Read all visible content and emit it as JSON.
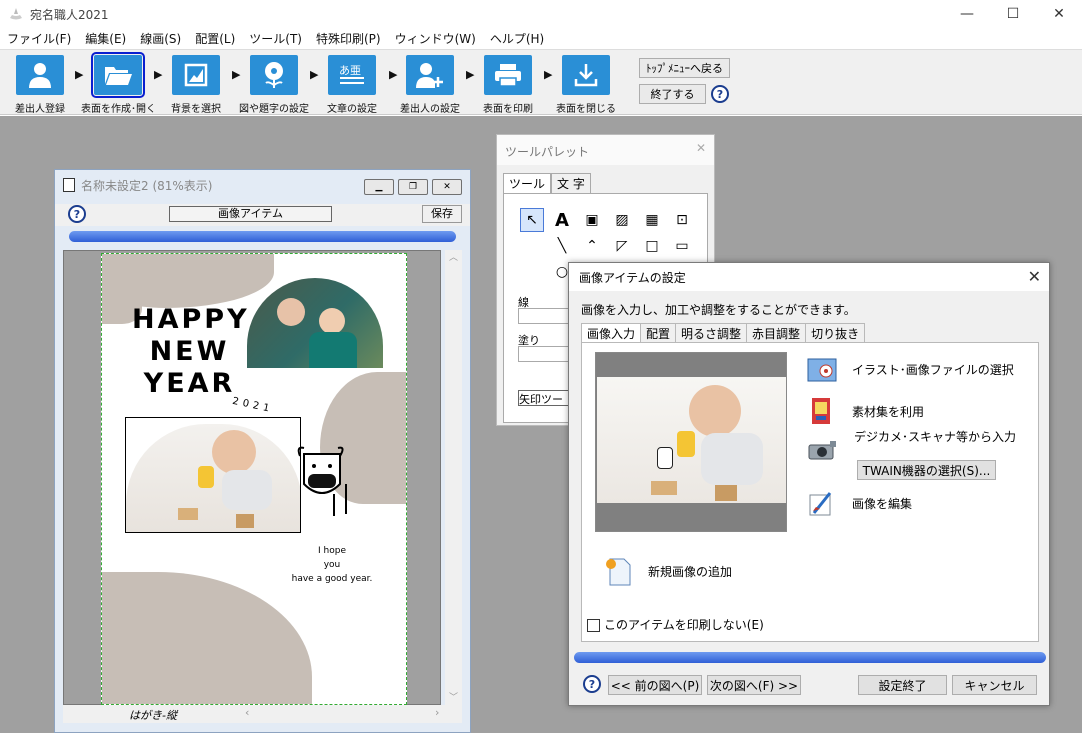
{
  "app": {
    "title": "宛名職人2021",
    "window_controls": {
      "minimize": "—",
      "maximize": "☐",
      "close": "✕"
    }
  },
  "menu": {
    "items": [
      {
        "label": "ファイル(F)"
      },
      {
        "label": "編集(E)"
      },
      {
        "label": "線画(S)"
      },
      {
        "label": "配置(L)"
      },
      {
        "label": "ツール(T)"
      },
      {
        "label": "特殊印刷(P)"
      },
      {
        "label": "ウィンドウ(W)"
      },
      {
        "label": "ヘルプ(H)"
      }
    ]
  },
  "toolbar": {
    "steps": [
      {
        "label": "差出人登録",
        "icon": "person-icon"
      },
      {
        "label": "表面を作成･開く",
        "icon": "folder-open-icon",
        "selected": true
      },
      {
        "label": "背景を選択",
        "icon": "picture-icon"
      },
      {
        "label": "図や題字の設定",
        "icon": "flower-icon"
      },
      {
        "label": "文章の設定",
        "icon": "text-doc-icon"
      },
      {
        "label": "差出人の設定",
        "icon": "person-add-icon"
      },
      {
        "label": "表面を印刷",
        "icon": "printer-icon"
      },
      {
        "label": "表面を閉じる",
        "icon": "download-icon"
      }
    ],
    "top_menu_button": "ﾄｯﾌﾟﾒﾆｭｰへ戻る",
    "exit_button": "終了する",
    "help": "?"
  },
  "document": {
    "title": "名称未設定2 (81%表示)",
    "item_label": "画像アイテム",
    "save_label": "保存",
    "help": "?",
    "status_text": "はがき-縦",
    "card": {
      "headline": [
        "HAPPY",
        "NEW",
        "YEAR"
      ],
      "year_text": "2021",
      "message": [
        "I hope",
        "you",
        "have a good year."
      ]
    }
  },
  "palette": {
    "title": "ツールパレット",
    "tabs": [
      {
        "label": "ツール",
        "active": true
      },
      {
        "label": "文 字",
        "active": false
      }
    ],
    "line_label": "線",
    "fill_label": "塗り",
    "arrow_label": "矢印ツー"
  },
  "dialog": {
    "title": "画像アイテムの設定",
    "close": "✕",
    "description": "画像を入力し、加工や調整をすることができます。",
    "tabs": [
      {
        "label": "画像入力",
        "active": true
      },
      {
        "label": "配置",
        "active": false
      },
      {
        "label": "明るさ調整",
        "active": false
      },
      {
        "label": "赤目調整",
        "active": false
      },
      {
        "label": "切り抜き",
        "active": false
      }
    ],
    "options": {
      "file_select": "イラスト･画像ファイルの選択",
      "material": "素材集を利用",
      "camera_input": "デジカメ･スキャナ等から入力",
      "twain_button": "TWAIN機器の選択(S)...",
      "edit_image": "画像を編集",
      "new_image": "新規画像の追加"
    },
    "no_print_checkbox": "このアイテムを印刷しない(E)",
    "no_print_checked": false,
    "buttons": {
      "help": "?",
      "prev": "<< 前の図へ(P)",
      "next": "次の図へ(F) >>",
      "done": "設定終了",
      "cancel": "キャンセル"
    }
  }
}
